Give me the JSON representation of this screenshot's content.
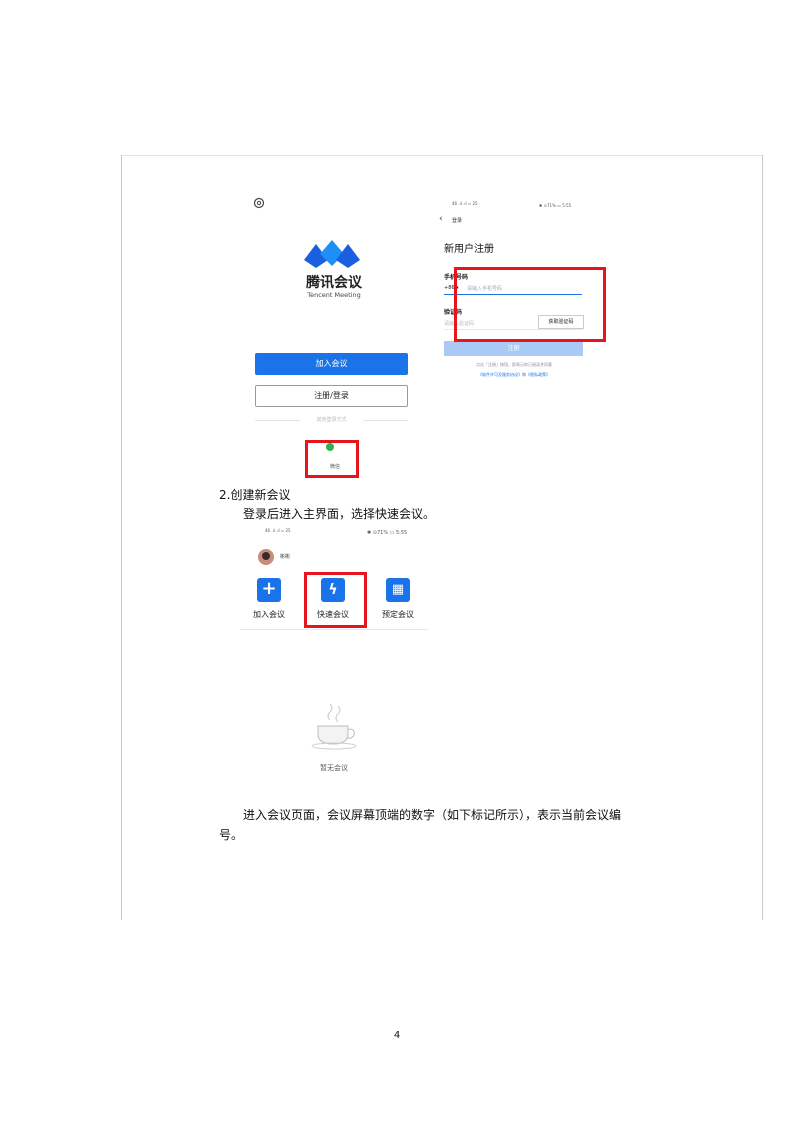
{
  "login_screen": {
    "brand_name": "腾讯会议",
    "brand_name_en": "Tencent Meeting",
    "join_button": "加入会议",
    "register_button": "注册/登录",
    "other_login": "其他登录方式",
    "wechat_label": "微信"
  },
  "register_screen": {
    "status_left": "46 .ıl .ıl ≈ 25",
    "status_right": "✱ ⊙71% ▭ 5:55",
    "back_label": "登录",
    "title": "新用户注册",
    "phone_label": "手机号码",
    "phone_prefix": "+86 ▾",
    "phone_placeholder": "请输入手机号码",
    "code_label": "验证码",
    "code_placeholder": "请输入验证码",
    "get_code_button": "获取验证码",
    "register_button": "注册",
    "terms_text": "点击「注册」按钮，即表示你已阅读并同意",
    "terms_links": "《软件许可及服务协议》和《隐私政策》"
  },
  "section": {
    "heading": "2.创建新会议",
    "paragraph": "登录后进入主界面，选择快速会议。"
  },
  "main_screen": {
    "status_left": "46 .ıl .ıl ≈ 25",
    "status_right": "✱ ⊙71% ▭ 5:55",
    "username": "彬彬",
    "tiles": [
      {
        "label": "加入会议",
        "icon": "plus-icon",
        "glyph": "+"
      },
      {
        "label": "快速会议",
        "icon": "lightning-icon",
        "glyph": "ϟ"
      },
      {
        "label": "预定会议",
        "icon": "calendar-icon",
        "glyph": "▦"
      }
    ],
    "empty_text": "暂无会议"
  },
  "paragraph2": {
    "line1": "进入会议页面，会议屏幕顶端的数字（如下标记所示），表示当前会议编",
    "line2": "号。"
  },
  "page_number": "4",
  "colors": {
    "accent": "#1a73e8",
    "highlight_box": "#e8141b",
    "wechat": "#2bb24c"
  }
}
